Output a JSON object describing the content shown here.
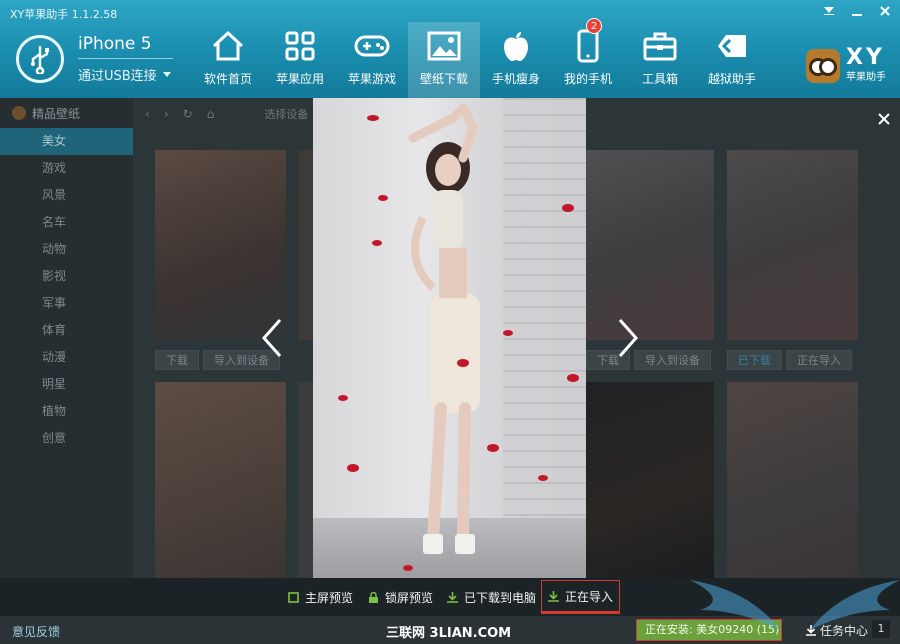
{
  "app": {
    "title": "XY苹果助手 1.1.2.58"
  },
  "device": {
    "name": "iPhone 5",
    "connection": "通过USB连接"
  },
  "nav": [
    {
      "label": "软件首页",
      "icon": "home-icon"
    },
    {
      "label": "苹果应用",
      "icon": "apps-grid-icon"
    },
    {
      "label": "苹果游戏",
      "icon": "gamepad-icon"
    },
    {
      "label": "壁纸下载",
      "icon": "wallpaper-icon",
      "active": true
    },
    {
      "label": "手机瘦身",
      "icon": "apple-icon"
    },
    {
      "label": "我的手机",
      "icon": "phone-icon",
      "badge": "2"
    },
    {
      "label": "工具箱",
      "icon": "toolbox-icon"
    },
    {
      "label": "越狱助手",
      "icon": "jailbreak-icon"
    }
  ],
  "logo": {
    "text": "XY",
    "sub": "苹果助手"
  },
  "sidebar": {
    "header": "精品壁纸",
    "items": [
      "美女",
      "游戏",
      "风景",
      "名车",
      "动物",
      "影视",
      "军事",
      "体育",
      "动漫",
      "明星",
      "植物",
      "创意"
    ],
    "active": "美女"
  },
  "toolbar": {
    "crumb": "选择设备"
  },
  "thumbs": {
    "download": "下载",
    "import": "导入到设备",
    "downloaded": "已下载",
    "importing": "正在导入"
  },
  "actions": {
    "fullscreen": "主屏预览",
    "lockscreen": "锁屏预览",
    "downloaded_pc": "已下载到电脑",
    "importing": "正在导入"
  },
  "status": {
    "feedback": "意见反馈",
    "watermark": "三联网 3LIAN.COM",
    "installing": "正在安装: 美女09240 (15)",
    "task_center": "任务中心",
    "task_count": "1"
  },
  "colors": {
    "header": "#1a8cad",
    "accent_red": "#d23a2f",
    "install_green": "#6aa13a"
  }
}
